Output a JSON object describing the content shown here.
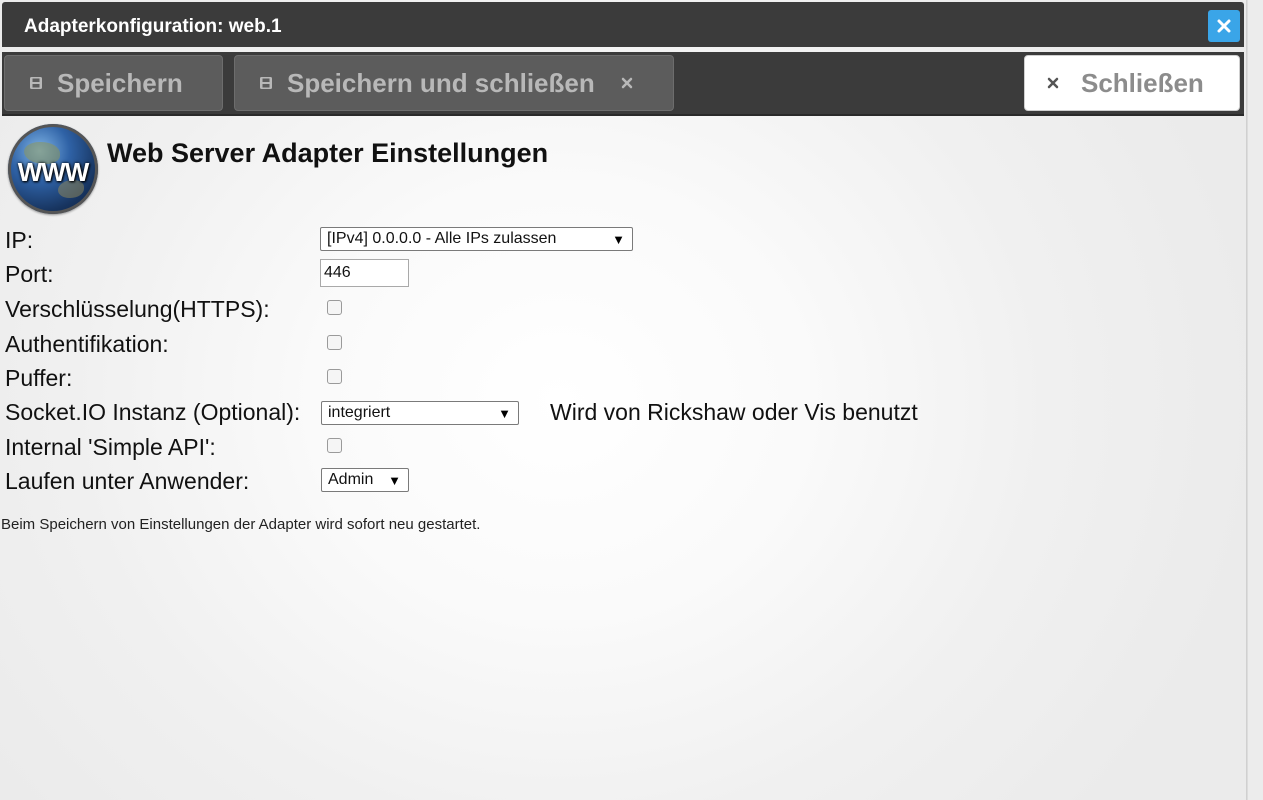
{
  "window": {
    "title": "Adapterkonfiguration: web.1"
  },
  "toolbar": {
    "save_label": "Speichern",
    "save_close_label": "Speichern und schließen",
    "close_label": "Schließen"
  },
  "logo": {
    "text": "WWW"
  },
  "page": {
    "heading": "Web Server Adapter Einstellungen",
    "footer_note": "Beim Speichern von Einstellungen der Adapter wird sofort neu gestartet."
  },
  "form": {
    "ip": {
      "label": "IP:",
      "value": "[IPv4] 0.0.0.0 - Alle IPs zulassen"
    },
    "port": {
      "label": "Port:",
      "value": "446"
    },
    "https": {
      "label": "Verschlüsselung(HTTPS):",
      "checked": false
    },
    "auth": {
      "label": "Authentifikation:",
      "checked": false
    },
    "cache": {
      "label": "Puffer:",
      "checked": false
    },
    "socketio": {
      "label": "Socket.IO Instanz (Optional):",
      "value": "integriert",
      "note": "Wird von Rickshaw oder Vis benutzt"
    },
    "simple_api": {
      "label": "Internal 'Simple API':",
      "checked": false
    },
    "run_as": {
      "label": "Laufen unter Anwender:",
      "value": "Admin"
    }
  },
  "colors": {
    "titlebar": "#3b3b3b",
    "close_accent": "#3aa5e8",
    "button_disabled": "#5c5c5c"
  },
  "icons": [
    "close-icon",
    "save-icon",
    "x-icon"
  ]
}
